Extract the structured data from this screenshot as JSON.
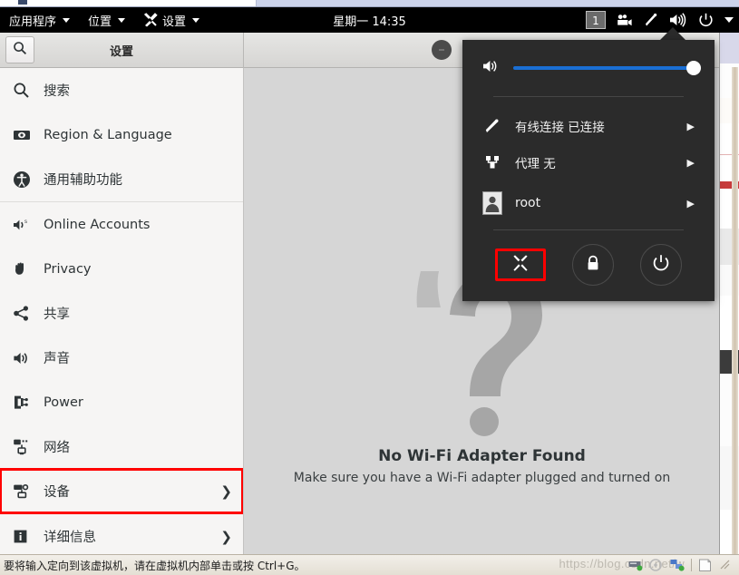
{
  "topbar": {
    "menus": [
      {
        "label": "应用程序",
        "icon": null
      },
      {
        "label": "位置",
        "icon": null
      },
      {
        "label": "设置",
        "icon": "settings-tools-icon"
      }
    ],
    "clock": "星期一  14:35",
    "workspace_indicator": "1",
    "right_icons": [
      "camera-icon",
      "pen-icon",
      "volume-icon",
      "power-icon",
      "chevron-down-icon"
    ]
  },
  "settings_window": {
    "title": "设置",
    "search_icon": "search-icon",
    "window_buttons": [
      "minimize-button",
      "maximize-button",
      "close-button"
    ]
  },
  "sidebar": {
    "groups": [
      {
        "items": [
          {
            "label": "搜索",
            "icon": "search-icon",
            "chevron": false,
            "highlight": false
          },
          {
            "label": "Region & Language",
            "icon": "region-language-icon",
            "chevron": false,
            "highlight": false
          },
          {
            "label": "通用辅助功能",
            "icon": "accessibility-icon",
            "chevron": false,
            "highlight": false
          }
        ]
      },
      {
        "items": [
          {
            "label": "Online Accounts",
            "icon": "online-accounts-icon",
            "chevron": false,
            "highlight": false
          },
          {
            "label": "Privacy",
            "icon": "privacy-hand-icon",
            "chevron": false,
            "highlight": false
          },
          {
            "label": "共享",
            "icon": "sharing-icon",
            "chevron": false,
            "highlight": false
          },
          {
            "label": "声音",
            "icon": "sound-icon",
            "chevron": false,
            "highlight": false
          },
          {
            "label": "Power",
            "icon": "power-plug-icon",
            "chevron": false,
            "highlight": false
          },
          {
            "label": "网络",
            "icon": "network-icon",
            "chevron": false,
            "highlight": false
          },
          {
            "label": "设备",
            "icon": "devices-icon",
            "chevron": true,
            "highlight": true
          }
        ]
      },
      {
        "items": [
          {
            "label": "详细信息",
            "icon": "info-icon",
            "chevron": true,
            "highlight": false
          }
        ]
      }
    ]
  },
  "main": {
    "illustration": "question-mark-illustration",
    "title": "No Wi-Fi Adapter Found",
    "subtitle": "Make sure you have a Wi-Fi adapter plugged and turned on"
  },
  "system_menu": {
    "volume": {
      "icon": "volume-icon",
      "value": 100
    },
    "rows": [
      {
        "icon": "wired-network-icon",
        "label": "有线连接 已连接",
        "chevron": "▶"
      },
      {
        "icon": "proxy-icon",
        "label": "代理 无",
        "chevron": "▶"
      },
      {
        "icon": "avatar-icon",
        "label": "root",
        "chevron": "▶"
      }
    ],
    "actions": [
      {
        "icon": "settings-tools-icon",
        "name": "settings-action",
        "selected": true
      },
      {
        "icon": "lock-icon",
        "name": "lock-action",
        "selected": false
      },
      {
        "icon": "power-icon",
        "name": "power-action",
        "selected": false
      }
    ]
  },
  "vm_status": {
    "text": "要将输入定向到该虚拟机，请在虚拟机内部单击或按 Ctrl+G。",
    "watermark": "https://blog.csdn.net/w",
    "tray_icons": [
      "disk-icon",
      "cd-icon",
      "network-adapter-icon",
      "printer-icon",
      "resize-grip"
    ]
  },
  "colors": {
    "accent_blue": "#1a6fd4",
    "highlight_red": "#ff0000",
    "panel_dark": "#2b2b2b",
    "sidebar_bg": "#f6f5f4"
  }
}
